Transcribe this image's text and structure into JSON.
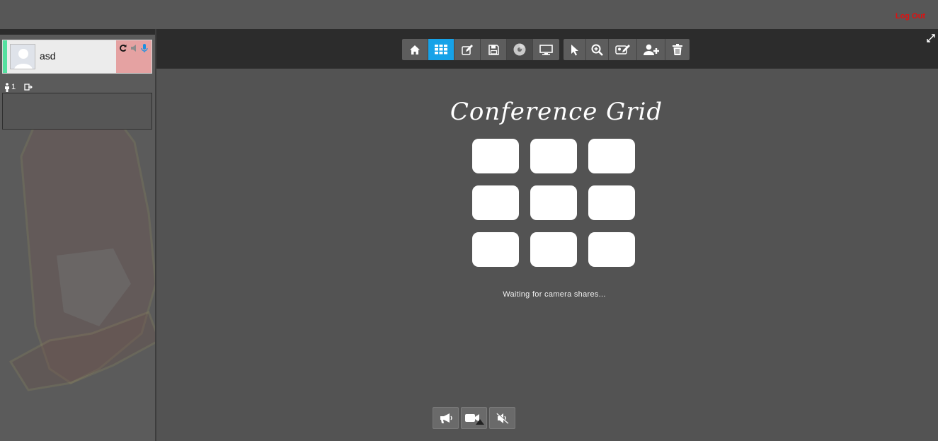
{
  "header": {
    "logout_label": "Log Out"
  },
  "sidebar": {
    "user": {
      "name": "asd"
    },
    "participant_count": "1"
  },
  "toolbar": {
    "buttons": [
      "home-icon",
      "grid-icon",
      "edit-icon",
      "save-icon",
      "disc-icon",
      "monitor-icon",
      "pointer-icon",
      "zoom-icon",
      "sign-icon",
      "add-user-icon",
      "trash-icon"
    ],
    "active": "grid-icon"
  },
  "main": {
    "title": "Conference Grid",
    "status": "Waiting for camera shares..."
  },
  "bottom_bar": {
    "buttons": [
      "megaphone-icon",
      "camera-icon",
      "mute-icon"
    ]
  },
  "colors": {
    "accent": "#16a2e8",
    "logout": "#e01010",
    "user_status": "#55e0a0",
    "user_controls_bg": "#e5a2a2"
  }
}
